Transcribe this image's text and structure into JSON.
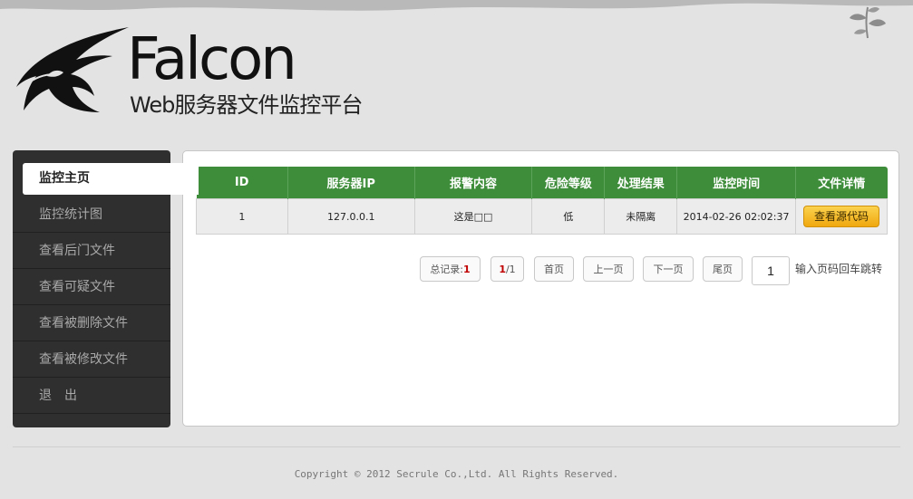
{
  "brand": {
    "title": "Falcon",
    "subtitle": "Web服务器文件监控平台"
  },
  "sidebar": {
    "items": [
      {
        "label": "监控主页",
        "active": true
      },
      {
        "label": "监控统计图"
      },
      {
        "label": "查看后门文件"
      },
      {
        "label": "查看可疑文件"
      },
      {
        "label": "查看被删除文件"
      },
      {
        "label": "查看被修改文件"
      },
      {
        "label": "退　出"
      }
    ]
  },
  "table": {
    "headers": [
      "ID",
      "服务器IP",
      "报警内容",
      "危险等级",
      "处理结果",
      "监控时间",
      "文件详情"
    ],
    "rows": [
      {
        "id": "1",
        "ip": "127.0.0.1",
        "alert": "这是□□",
        "level": "低",
        "result": "未隔离",
        "time": "2014-02-26 02:02:37",
        "action": "查看源代码"
      }
    ]
  },
  "pager": {
    "total_label": "总记录:",
    "total": "1",
    "page_current": "1",
    "page_total": "/1",
    "first": "首页",
    "prev": "上一页",
    "next": "下一页",
    "last": "尾页",
    "input_value": "1",
    "jump_label": "输入页码回车跳转"
  },
  "footer": {
    "copyright": "Copyright © 2012 Secrule Co.,Ltd. All Rights Reserved."
  },
  "colors": {
    "header_green": "#3e8d3a",
    "sidebar_bg": "#2f2f2f",
    "button_orange": "#f0a80f",
    "accent_red": "#c00000"
  }
}
